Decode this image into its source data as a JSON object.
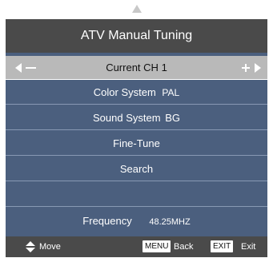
{
  "header": {
    "title": "ATV Manual Tuning"
  },
  "current_channel": {
    "label": "Current CH",
    "value": "1"
  },
  "rows": {
    "color_system": {
      "label": "Color System",
      "value": "PAL"
    },
    "sound_system": {
      "label": "Sound System",
      "value": "BG"
    },
    "fine_tune": {
      "label": "Fine-Tune"
    },
    "search": {
      "label": "Search"
    },
    "frequency": {
      "label": "Frequency",
      "value": "48.25MHZ"
    }
  },
  "footer": {
    "move_label": "Move",
    "menu_key": "MENU",
    "back_label": "Back",
    "exit_key": "EXIT",
    "exit_label": "Exit"
  },
  "colors": {
    "panel": "#4b5f7e",
    "header_footer": "#4a4a4a",
    "selected_row": "#b9b9b9"
  },
  "icons": {
    "scroll_up": "up-triangle-icon",
    "left": "left-triangle-icon",
    "minus": "minus-icon",
    "plus": "plus-icon",
    "right": "right-triangle-icon",
    "move": "up-down-arrows-icon"
  }
}
